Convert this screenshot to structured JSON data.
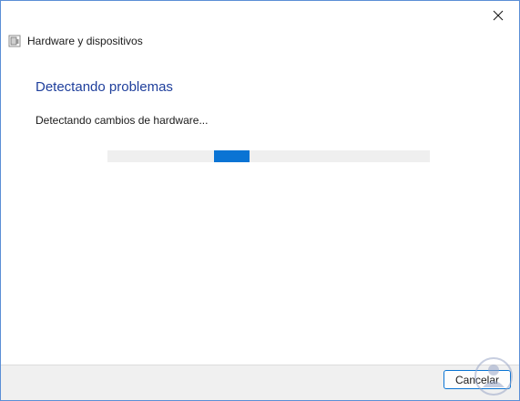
{
  "window": {
    "title": "Hardware y dispositivos",
    "close_icon": "close-icon",
    "app_icon": "hardware-devices-icon"
  },
  "main": {
    "heading": "Detectando problemas",
    "status": "Detectando cambios de hardware...",
    "progress": {
      "mode": "indeterminate",
      "chunk_start_fraction": 0.33,
      "chunk_width_fraction": 0.11,
      "color": "#0a74d4",
      "track_color": "#efefef"
    }
  },
  "footer": {
    "cancel_label": "Cancelar"
  },
  "colors": {
    "heading": "#1f3f9c",
    "accent": "#0a74d4",
    "window_border": "#5b8fd6"
  }
}
